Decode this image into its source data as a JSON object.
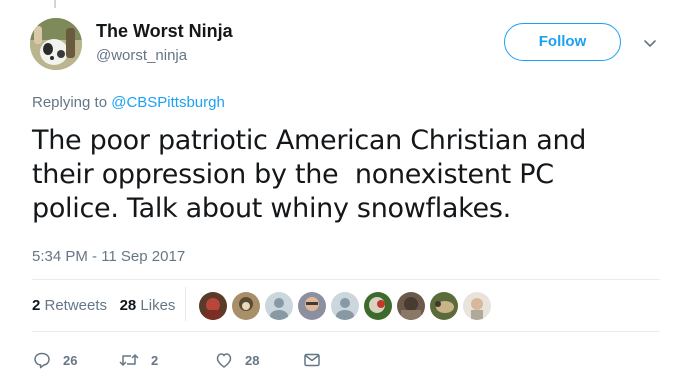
{
  "author": {
    "name": "The Worst Ninja",
    "handle": "@worst_ninja"
  },
  "follow_button": {
    "label": "Follow"
  },
  "reply": {
    "prefix": "Replying to ",
    "mention": "@CBSPittsburgh"
  },
  "tweet": {
    "text": "The poor patriotic American Christian and\ntheir oppression by the  nonexistent PC\npolice. Talk about whiny snowflakes.",
    "timestamp": "5:34 PM - 11 Sep 2017"
  },
  "stats": {
    "retweets_count": "2",
    "retweets_label": " Retweets",
    "likes_count": "28",
    "likes_label": " Likes"
  },
  "actions": {
    "replies": "26",
    "retweets": "2",
    "likes": "28"
  },
  "icons": {
    "reply": "reply-icon",
    "retweet": "retweet-icon",
    "like": "heart-icon",
    "message": "envelope-icon",
    "caret": "chevron-down-icon"
  },
  "colors": {
    "accent": "#1da1f2",
    "secondary_text": "#657786",
    "primary_text": "#14171a",
    "divider": "#e6ecf0"
  }
}
